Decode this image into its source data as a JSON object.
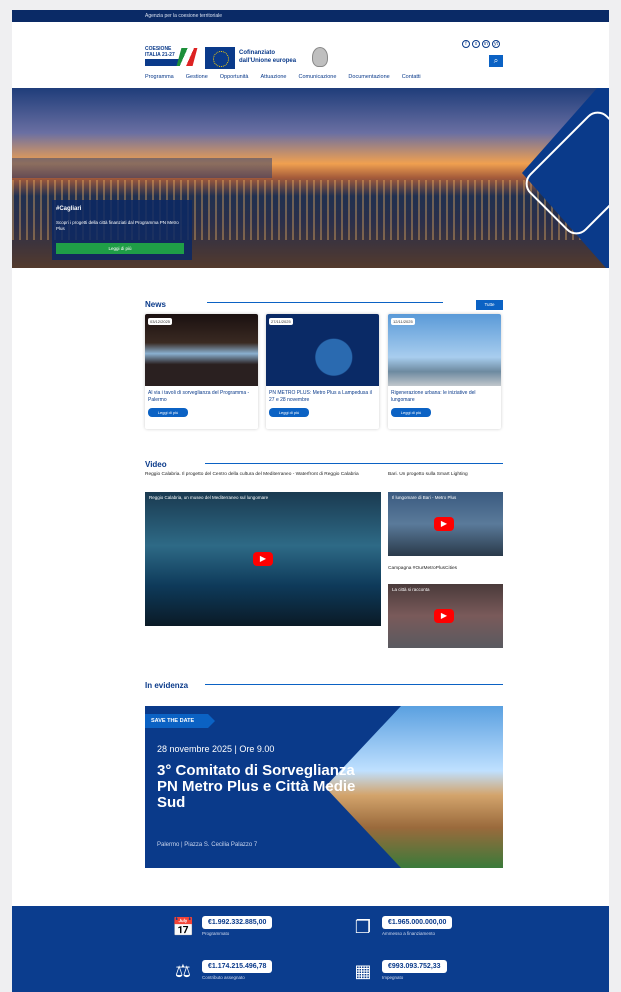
{
  "topbar": {
    "text": "Agenzia per la coesione territoriale"
  },
  "header": {
    "logo_text": "COESIONE ITALIA 21-27",
    "eu_text_line1": "Cofinanziato",
    "eu_text_line2": "dall'Unione europea",
    "socials": [
      "f",
      "x",
      "in",
      "yt"
    ]
  },
  "nav": {
    "items": [
      "Programma",
      "Gestione",
      "Opportunità",
      "Attuazione",
      "Comunicazione",
      "Documentazione",
      "Contatti"
    ]
  },
  "hero": {
    "title": "#Cagliari",
    "text": "Scopri i progetti della città finanziati dal Programma PN Metro Plus",
    "button": "Leggi di più"
  },
  "news": {
    "title": "News",
    "all_button": "Tutte",
    "cards": [
      {
        "date": "03/12/2025",
        "title": "Al via i tavoli di sorveglianza del Programma - Palermo",
        "button": "Leggi di più"
      },
      {
        "date": "27/11/2025",
        "title": "PN METRO PLUS: Metro Plus a Lampedusa il 27 e 28 novembre",
        "button": "Leggi di più"
      },
      {
        "date": "12/11/2025",
        "title": "Rigenerazione urbana: le iniziative del lungomare",
        "button": "Leggi di più"
      }
    ]
  },
  "video": {
    "title": "Video",
    "main_caption": "Reggio Calabria. Il progetto del Centro della cultura del Mediterraneo - Waterfront di Reggio Calabria",
    "main_title": "Reggio Calabria, un museo del Mediterraneo sul lungomare",
    "side1_caption": "Bari. Un progetto sulla Smart Lighting",
    "side1_title": "Il lungomare di Bari - Metro Plus",
    "side2_caption": "Campagna #OurMetroPlusCities",
    "side2_title": "La città si racconta"
  },
  "evidenza": {
    "title": "In evidenza",
    "tag": "SAVE THE DATE",
    "date": "28 novembre 2025 | Ore 9.00",
    "headline": "3° Comitato di Sorveglianza PN Metro Plus e Città Medie Sud",
    "place": "Palermo | Piazza S. Cecilia Palazzo 7"
  },
  "stats": [
    {
      "value": "€1.992.332.885,00",
      "label": "Programmato",
      "icon": "calendar-check-icon"
    },
    {
      "value": "€1.965.000.000,00",
      "label": "Ammesso a finanziamento",
      "icon": "copy-icon"
    },
    {
      "value": "€1.174.215.496,78",
      "label": "Contributo assegnato",
      "icon": "scale-icon"
    },
    {
      "value": "€993.093.752,33",
      "label": "Impegnato",
      "icon": "calculator-icon"
    }
  ]
}
